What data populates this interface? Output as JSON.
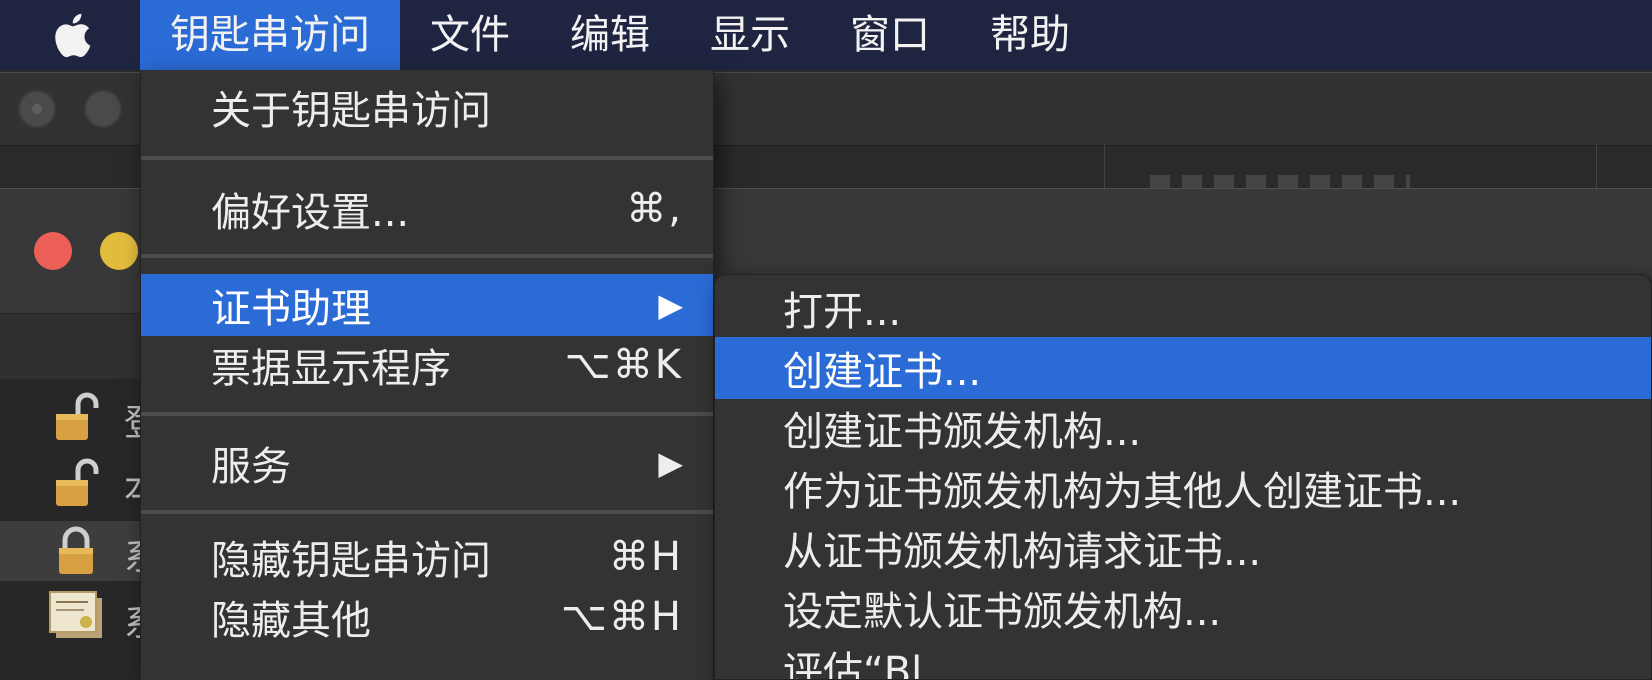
{
  "menubar": {
    "apple_icon": "apple-logo-icon",
    "items": [
      "钥匙串访问",
      "文件",
      "编辑",
      "显示",
      "窗口",
      "帮助"
    ],
    "active_index": 0,
    "active_color": "#2b6bd6"
  },
  "app_menu": {
    "items": [
      {
        "label": "关于钥匙串访问",
        "shortcut": ""
      },
      {
        "label": "偏好设置...",
        "shortcut": "⌘,"
      },
      {
        "label": "证书助理",
        "shortcut": "",
        "submenu_arrow": "▶",
        "highlighted": true
      },
      {
        "label": "票据显示程序",
        "shortcut": "⌥⌘K"
      },
      {
        "label": "服务",
        "shortcut": "",
        "submenu_arrow": "▶"
      },
      {
        "label": "隐藏钥匙串访问",
        "shortcut": "⌘H"
      },
      {
        "label": "隐藏其他",
        "shortcut": "⌥⌘H"
      }
    ]
  },
  "certificate_assistant_submenu": {
    "items": [
      "打开...",
      "创建证书...",
      "创建证书颁发机构...",
      "作为证书颁发机构为其他人创建证书...",
      "从证书颁发机构请求证书...",
      "设定默认证书颁发机构...",
      "评估“Bl"
    ],
    "highlighted_index": 1
  },
  "sidebar": {
    "rows": [
      {
        "icon": "unlocked-padlock-icon",
        "text": "登"
      },
      {
        "icon": "unlocked-padlock-icon",
        "text": "本"
      },
      {
        "icon": "locked-padlock-icon",
        "text": "系"
      },
      {
        "icon": "certificate-icon",
        "text": "系"
      }
    ]
  },
  "window": {
    "traffic_lights": {
      "close": "#ec5f56",
      "minimize": "#e2bd3d"
    }
  }
}
